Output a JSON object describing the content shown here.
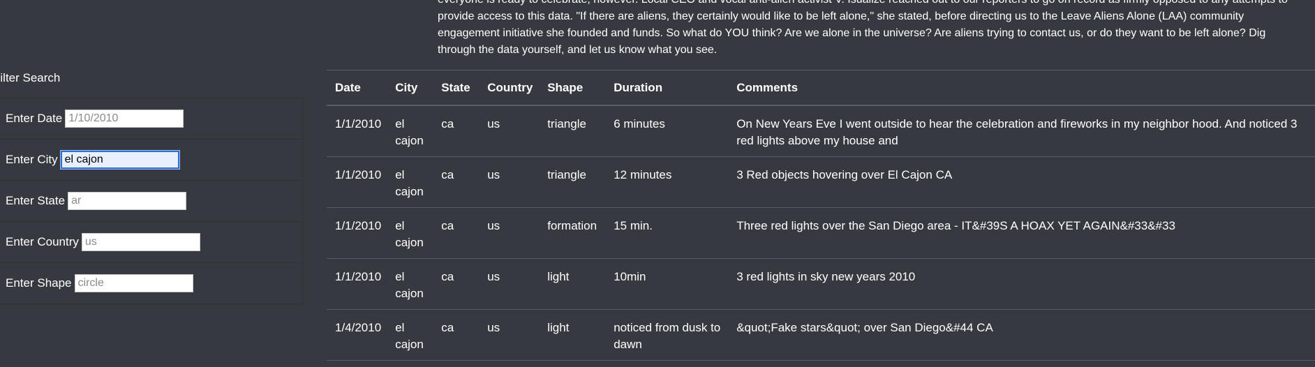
{
  "intro": {
    "text": "everyone is ready to celebrate, however. Local CEO and vocal anti-alien activist V. Isualize reached out to our reporters to go on record as firmly opposed to any attempts to provide access to this data. \"If there are aliens, they certainly would like to be left alone,\" she stated, before directing us to the Leave Aliens Alone (LAA) community engagement initiative she founded and funds. So what do YOU think? Are we alone in the universe? Are aliens trying to contact us, or do they want to be left alone? Dig through the data yourself, and let us know what you see."
  },
  "filter": {
    "title": "Filter Search",
    "fields": [
      {
        "label": "Enter Date",
        "value": "",
        "placeholder": "1/10/2010"
      },
      {
        "label": "Enter City",
        "value": "el cajon",
        "placeholder": ""
      },
      {
        "label": "Enter State",
        "value": "",
        "placeholder": "ar"
      },
      {
        "label": "Enter Country",
        "value": "",
        "placeholder": "us"
      },
      {
        "label": "Enter Shape",
        "value": "",
        "placeholder": "circle"
      }
    ]
  },
  "table": {
    "headers": [
      "Date",
      "City",
      "State",
      "Country",
      "Shape",
      "Duration",
      "Comments"
    ],
    "rows": [
      [
        "1/1/2010",
        "el cajon",
        "ca",
        "us",
        "triangle",
        "6 minutes",
        "On New Years Eve I went outside to hear the celebration and fireworks in my neighbor hood. And noticed 3 red lights above my house and"
      ],
      [
        "1/1/2010",
        "el cajon",
        "ca",
        "us",
        "triangle",
        "12 minutes",
        "3 Red objects hovering over El Cajon CA"
      ],
      [
        "1/1/2010",
        "el cajon",
        "ca",
        "us",
        "formation",
        "15 min.",
        "Three red lights over the San Diego area - IT&#39S A HOAX YET AGAIN&#33&#33"
      ],
      [
        "1/1/2010",
        "el cajon",
        "ca",
        "us",
        "light",
        "10min",
        "3 red lights in sky new years 2010"
      ],
      [
        "1/4/2010",
        "el cajon",
        "ca",
        "us",
        "light",
        "noticed from dusk to dawn",
        "&quot;Fake stars&quot; over San Diego&#44 CA"
      ]
    ]
  },
  "colors": {
    "background": "#363a40",
    "text": "#ffffff",
    "focus_ring": "#2f6fce"
  }
}
